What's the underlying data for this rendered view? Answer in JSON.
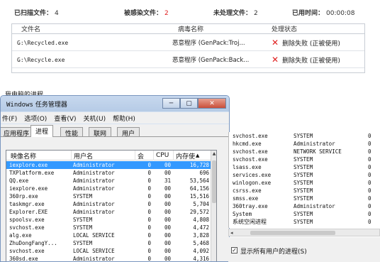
{
  "stats": {
    "scanned_label": "已扫描文件：",
    "scanned_value": "4",
    "infected_label": "被感染文件：",
    "infected_value": "2",
    "unprocessed_label": "未处理文件：",
    "unprocessed_value": "2",
    "time_label": "已用时间：",
    "time_value": "00:00:08"
  },
  "scan_table": {
    "headers": [
      "文件名",
      "病毒名称",
      "处理状态"
    ],
    "rows": [
      [
        "G:\\Recycled.exe",
        "恶意程序 (GenPack:Troj...",
        "删除失败 (正被使用)"
      ],
      [
        "G:\\Recycle.exe",
        "恶意程序 (GenPack:Back...",
        "删除失败 (正被使用)"
      ]
    ]
  },
  "section_title": "我电脑的进程",
  "taskmgr": {
    "title_en": "Windows",
    "title_cn": "任务管理器",
    "menu": [
      "件(F)",
      "选项(O)",
      "查看(V)",
      "关机(U)",
      "帮助(H)"
    ],
    "tabs": [
      "应用程序",
      "进程",
      "性能",
      "联网",
      "用户"
    ],
    "active_tab": "进程",
    "columns": [
      "映像名称",
      "用户名",
      "会",
      "CPU",
      "内存使"
    ],
    "rows": [
      [
        "iexplore.exe",
        "Administrator",
        "0",
        "00",
        "16,728"
      ],
      [
        "TXPlatform.exe",
        "Administrator",
        "0",
        "00",
        "696"
      ],
      [
        "QQ.exe",
        "Administrator",
        "0",
        "31",
        "53,564"
      ],
      [
        "iexplore.exe",
        "Administrator",
        "0",
        "00",
        "64,156"
      ],
      [
        "360rp.exe",
        "SYSTEM",
        "0",
        "00",
        "15,516"
      ],
      [
        "taskmgr.exe",
        "Administrator",
        "0",
        "00",
        "5,704"
      ],
      [
        "Explorer.EXE",
        "Administrator",
        "0",
        "00",
        "29,572"
      ],
      [
        "spoolsv.exe",
        "SYSTEM",
        "0",
        "00",
        "4,808"
      ],
      [
        "svchost.exe",
        "SYSTEM",
        "0",
        "00",
        "4,472"
      ],
      [
        "alg.exe",
        "LOCAL SERVICE",
        "0",
        "00",
        "3,828"
      ],
      [
        "ZhuDongFangY...",
        "SYSTEM",
        "0",
        "00",
        "5,468"
      ],
      [
        "svchost.exe",
        "LOCAL SERVICE",
        "0",
        "00",
        "4,092"
      ],
      [
        "360sd.exe",
        "Administrator",
        "0",
        "00",
        "4,316"
      ]
    ]
  },
  "right_panel": {
    "rows": [
      [
        "svchost.exe",
        "SYSTEM",
        "0"
      ],
      [
        "hkcmd.exe",
        "Administrator",
        "0"
      ],
      [
        "svchost.exe",
        "NETWORK SERVICE",
        "0"
      ],
      [
        "svchost.exe",
        "SYSTEM",
        "0"
      ],
      [
        "lsass.exe",
        "SYSTEM",
        "0"
      ],
      [
        "services.exe",
        "SYSTEM",
        "0"
      ],
      [
        "winlogon.exe",
        "SYSTEM",
        "0"
      ],
      [
        "csrss.exe",
        "SYSTEM",
        "0"
      ],
      [
        "smss.exe",
        "SYSTEM",
        "0"
      ],
      [
        "360tray.exe",
        "Administrator",
        "0"
      ],
      [
        "System",
        "SYSTEM",
        "0"
      ],
      [
        "系统空闲进程",
        "SYSTEM",
        "0"
      ]
    ],
    "show_all_label": "显示所有用户的进程(S)",
    "show_all_checked": true
  },
  "colors": {
    "accent_red": "#e02020",
    "selection": "#3399ff",
    "titlebar": "#c7d8ee"
  }
}
